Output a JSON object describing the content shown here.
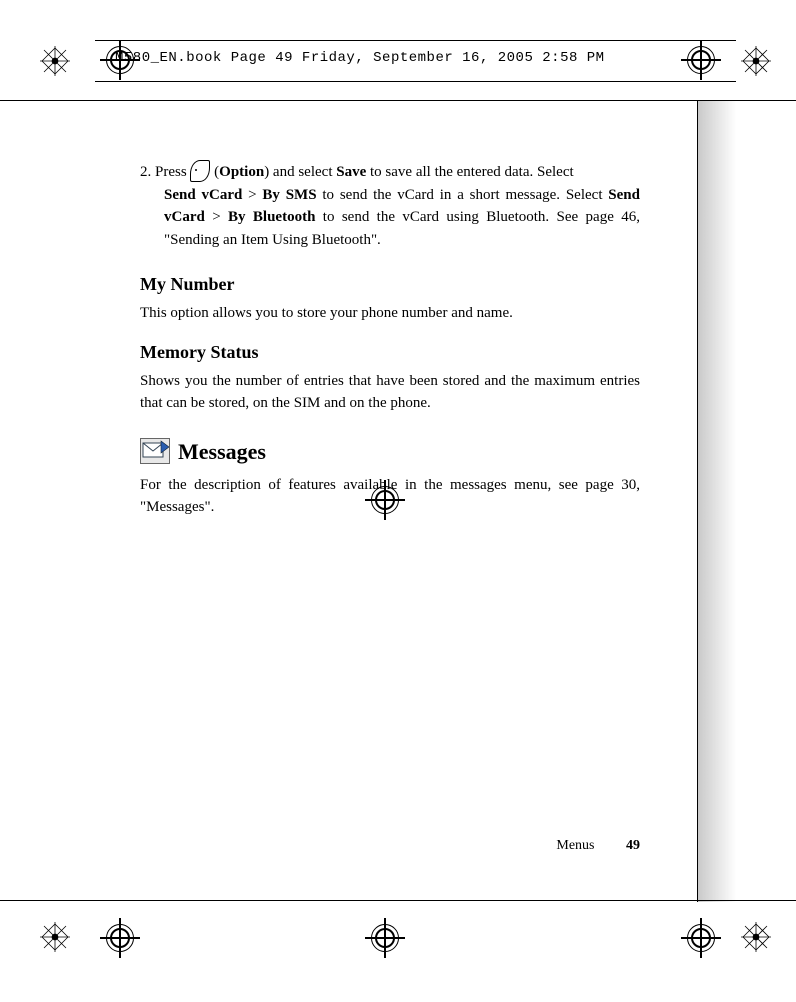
{
  "header": {
    "running": "M580_EN.book  Page 49  Friday, September 16, 2005  2:58 PM"
  },
  "step2": {
    "prefix": "2. Press ",
    "option_open": " (",
    "option": "Option",
    "option_close": ") and select ",
    "save": "Save",
    "after_save": " to save all the entered data. Select ",
    "send1": "Send vCard",
    "gt1": " > ",
    "bysms": "By SMS",
    "after_sms": " to send the vCard in a short message. Select ",
    "send2": "Send vCard",
    "gt2": " > ",
    "bybt": "By Bluetooth",
    "after_bt": " to send the vCard using Bluetooth. See page 46, \"Sending an Item Using Bluetooth\"."
  },
  "mynumber": {
    "heading": "My Number",
    "body": "This option allows you to store your phone number and name."
  },
  "memstatus": {
    "heading": "Memory Status",
    "body": "Shows you the number of entries that have been stored and the maximum entries that can be stored, on the SIM and on the phone."
  },
  "messages": {
    "heading": "Messages",
    "body": "For the description of features available in the messages menu, see page 30, \"Messages\"."
  },
  "footer": {
    "section": "Menus",
    "page": "49"
  }
}
